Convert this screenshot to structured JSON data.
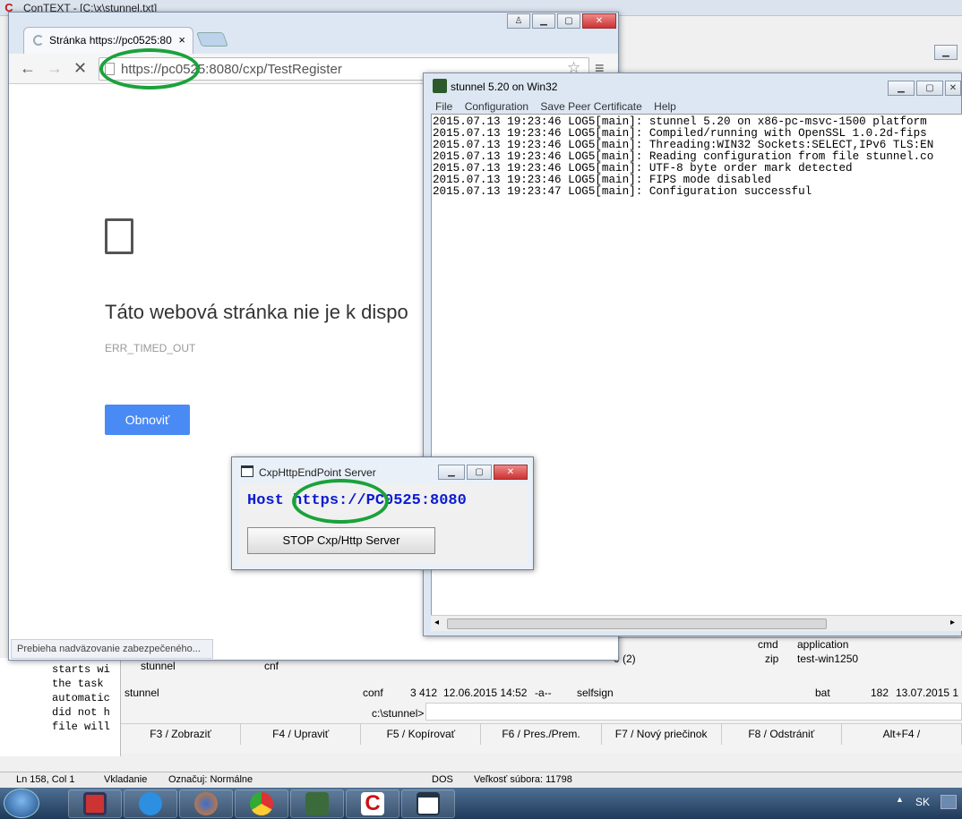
{
  "context": {
    "title": "ConTEXT - [C:\\x\\stunnel.txt]",
    "editor_lines": [
      "starts wi",
      "the task",
      "automatic",
      "did not h",
      "file will"
    ],
    "panel": {
      "left_row1": {
        "name": "stunnel",
        "ext": "cnf"
      },
      "left_row2": {
        "name": "stunnel",
        "ext": "conf",
        "size": "3 412",
        "date": "12.06.2015 14:52",
        "attr": "-a--"
      },
      "right_row1": {
        "ext": "cmd",
        "name": "application"
      },
      "right_row2": {
        "count": "0 (2)",
        "ext": "zip",
        "name": "test-win1250"
      },
      "right_row3": {
        "name": "selfsign",
        "ext": "bat",
        "size": "182",
        "date": "13.07.2015 1"
      },
      "path_prompt": "c:\\stunnel>",
      "fkeys": [
        "F3 / Zobraziť",
        "F4 / Upraviť",
        "F5 / Kopírovať",
        "F6 / Pres./Prem.",
        "F7 / Nový priečinok",
        "F8 / Odstrániť",
        "Alt+F4 /"
      ]
    },
    "status": {
      "pos": "Ln 158, Col 1",
      "mode": "Vkladanie",
      "mark": "Označuj: Normálne",
      "eol": "DOS",
      "size": "Veľkosť súbora: 11798"
    }
  },
  "chrome": {
    "tab_label": "Stránka https://pc0525:80",
    "url": "https://pc0525:8080/cxp/TestRegister",
    "error_title": "Táto webová stránka nie je k dispo",
    "error_code": "ERR_TIMED_OUT",
    "reload_label": "Obnoviť",
    "status": "Prebieha nadväzovanie zabezpečeného..."
  },
  "stunnel": {
    "title": "stunnel 5.20 on Win32",
    "menu": [
      "File",
      "Configuration",
      "Save Peer Certificate",
      "Help"
    ],
    "log": [
      "2015.07.13 19:23:46 LOG5[main]: stunnel 5.20 on x86-pc-msvc-1500 platform",
      "2015.07.13 19:23:46 LOG5[main]: Compiled/running with OpenSSL 1.0.2d-fips",
      "2015.07.13 19:23:46 LOG5[main]: Threading:WIN32 Sockets:SELECT,IPv6 TLS:EN",
      "2015.07.13 19:23:46 LOG5[main]: Reading configuration from file stunnel.co",
      "2015.07.13 19:23:46 LOG5[main]: UTF-8 byte order mark detected",
      "2015.07.13 19:23:46 LOG5[main]: FIPS mode disabled",
      "2015.07.13 19:23:47 LOG5[main]: Configuration successful"
    ]
  },
  "cxp": {
    "title": "CxpHttpEndPoint Server",
    "host_text": "Host https://PC0525:8080",
    "stop_label": "STOP Cxp/Http Server"
  },
  "taskbar": {
    "lang": "SK"
  },
  "colors": {
    "highlight_ring": "#1aa23a",
    "host_text": "#0b1bd0",
    "reload_button": "#4a8af4"
  }
}
